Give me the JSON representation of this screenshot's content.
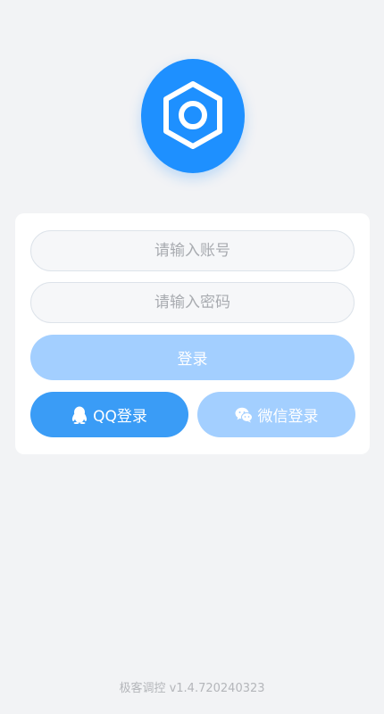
{
  "logo": {
    "icon": "hexagon-nut-icon",
    "color": "#1e90ff"
  },
  "form": {
    "account_placeholder": "请输入账号",
    "password_placeholder": "请输入密码",
    "login_label": "登录",
    "qq_login_label": "QQ登录",
    "wechat_login_label": "微信登录"
  },
  "icons": {
    "qq": "qq-penguin-icon",
    "wechat": "wechat-icon"
  },
  "footer": {
    "version": "极客调控 v1.4.720240323"
  },
  "colors": {
    "background": "#f2f3f5",
    "primary": "#3a9cf6",
    "primary_light": "#a3cfff"
  }
}
